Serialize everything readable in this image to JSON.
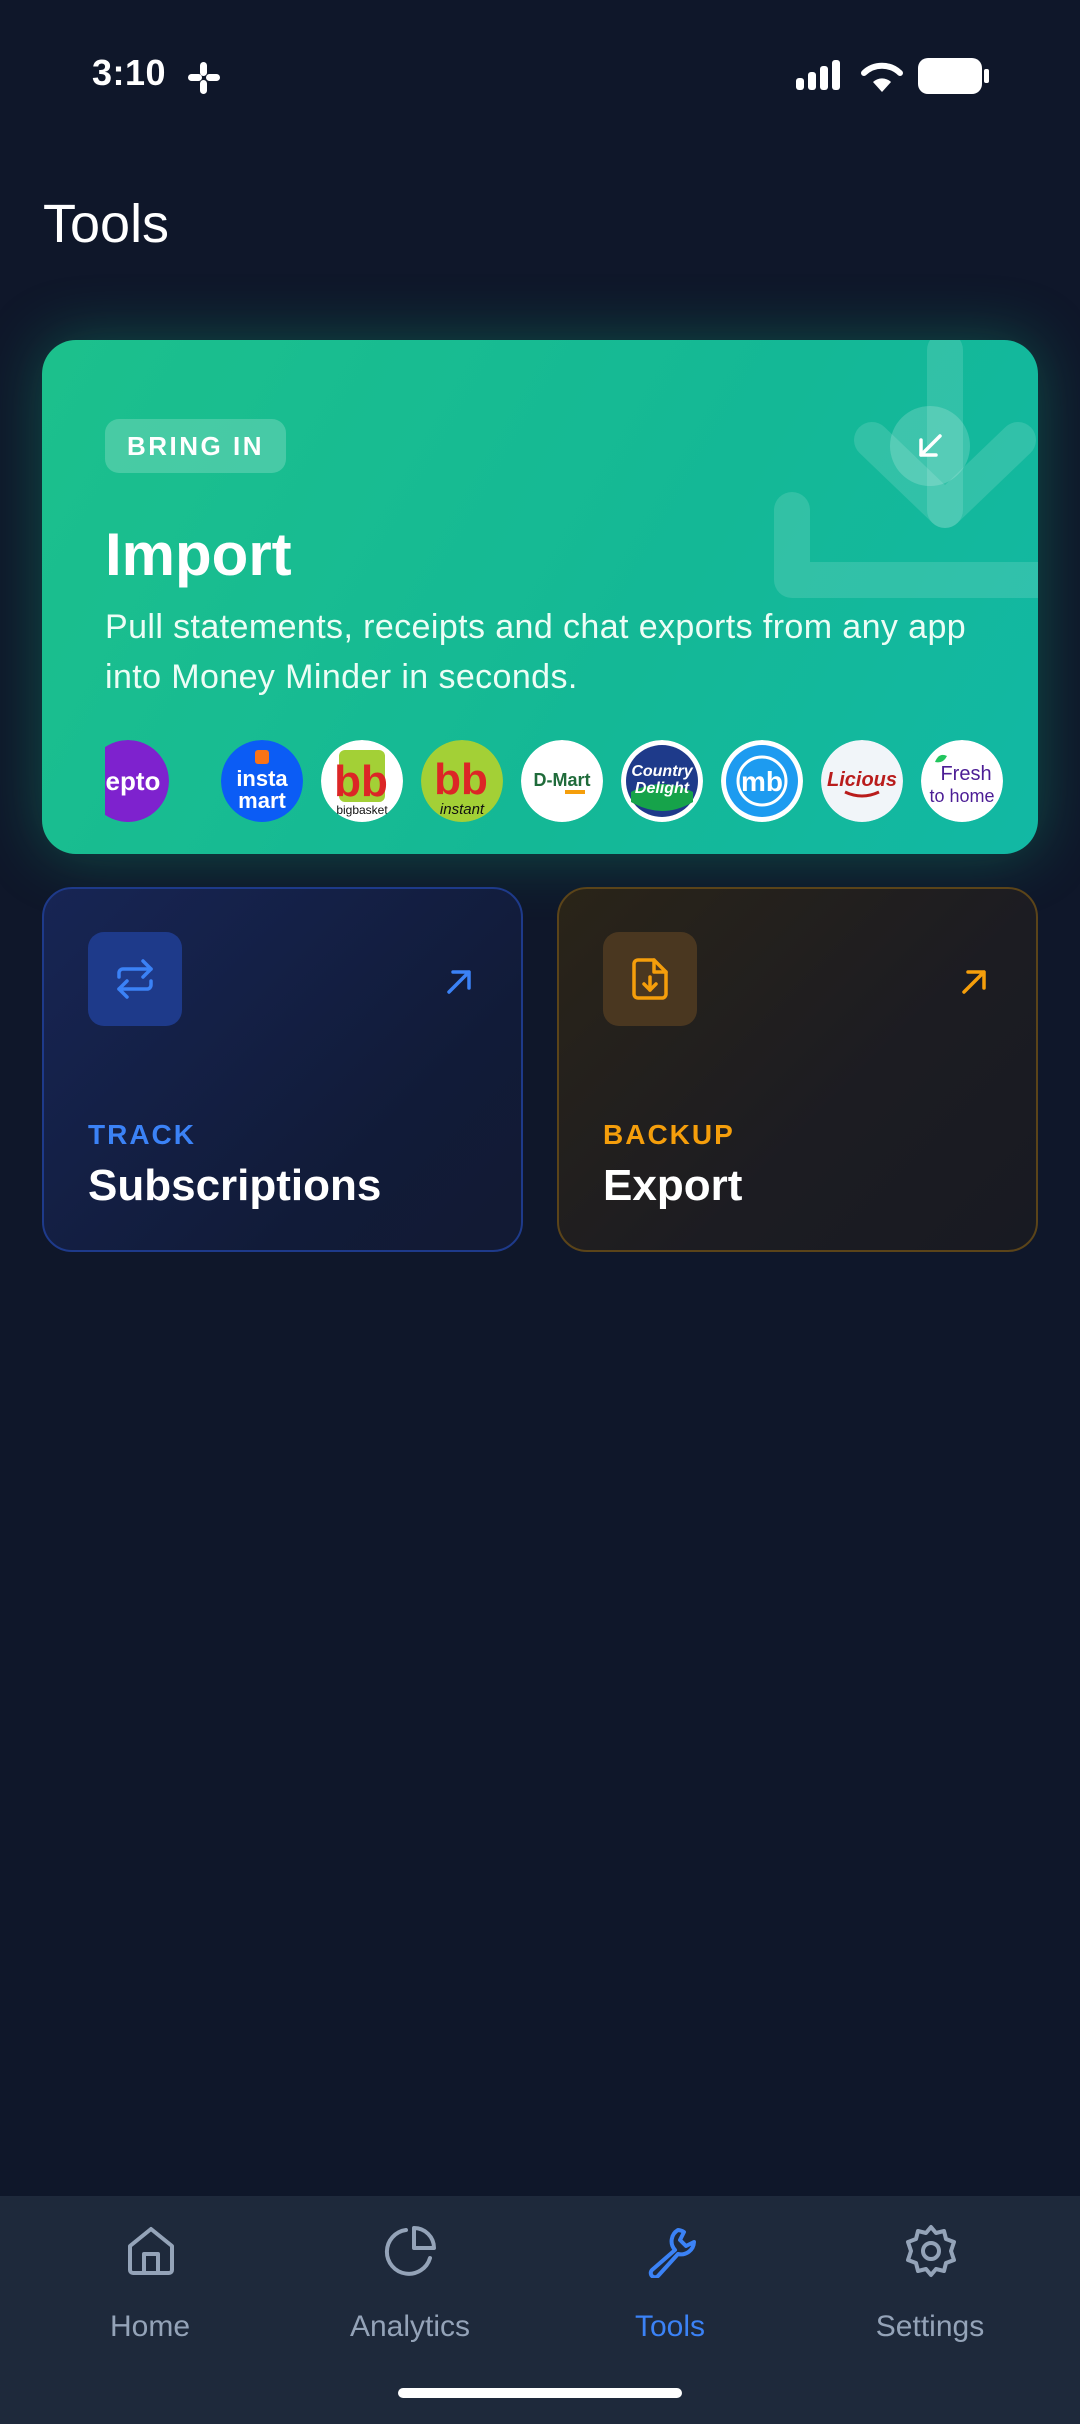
{
  "status_bar": {
    "time": "3:10",
    "icons": [
      "slack-icon",
      "signal-icon",
      "wifi-icon",
      "battery-icon"
    ]
  },
  "page": {
    "title": "Tools"
  },
  "import_card": {
    "tag": "BRING IN",
    "title": "Import",
    "description": "Pull statements, receipts and chat exports from any app into Money Minder in seconds.",
    "logos": [
      {
        "name": "zepto",
        "text": "epto",
        "bg": "#7e22ce",
        "fg": "#ffffff"
      },
      {
        "name": "instamart",
        "text1": "insta",
        "text2": "mart",
        "bg": "#0b5cf5",
        "fg": "#ffffff"
      },
      {
        "name": "bigbasket",
        "text": "bigbasket",
        "bg": "#ffffff",
        "fg": "#111111"
      },
      {
        "name": "bb-instant",
        "text": "instant",
        "bg": "#a3d036",
        "fg": "#111111"
      },
      {
        "name": "dmart",
        "text": "D-Mart",
        "bg": "#ffffff",
        "fg": "#1f6b3a"
      },
      {
        "name": "country-delight",
        "text1": "Country",
        "text2": "Delight",
        "bg": "#1e3a8a",
        "fg": "#ffffff"
      },
      {
        "name": "milkbasket",
        "text": "mb",
        "bg": "#1d9bf0",
        "fg": "#ffffff"
      },
      {
        "name": "licious",
        "text": "Licious",
        "bg": "#f8fafc",
        "fg": "#b91c1c"
      },
      {
        "name": "fresh-to-home",
        "text1": "Fresh",
        "text2": "to home",
        "bg": "#ffffff",
        "fg": "#4c1d95"
      }
    ],
    "colors": {
      "bg_start": "#1cc08c",
      "bg_end": "#12b8a4"
    }
  },
  "cards": [
    {
      "id": "subscriptions",
      "tag": "TRACK",
      "title": "Subscriptions",
      "icon": "repeat-icon",
      "accent": "#3b82f6"
    },
    {
      "id": "export",
      "tag": "BACKUP",
      "title": "Export",
      "icon": "file-download-icon",
      "accent": "#f59e0b"
    }
  ],
  "bottom_nav": {
    "items": [
      {
        "label": "Home",
        "icon": "home-icon",
        "active": false
      },
      {
        "label": "Analytics",
        "icon": "pie-chart-icon",
        "active": false
      },
      {
        "label": "Tools",
        "icon": "wrench-icon",
        "active": true
      },
      {
        "label": "Settings",
        "icon": "gear-icon",
        "active": false
      }
    ],
    "colors": {
      "active": "#3b82f6",
      "inactive": "#94a3b8"
    }
  }
}
